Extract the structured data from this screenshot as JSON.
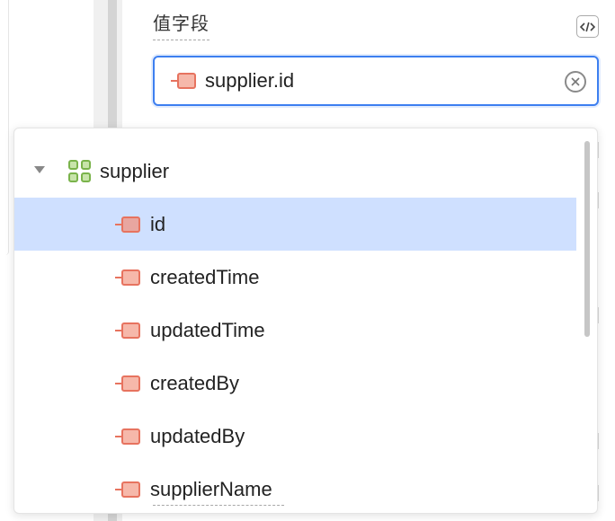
{
  "field": {
    "label": "值字段",
    "value": "supplier.id",
    "code_toggle_icon": "code-icon",
    "clear_icon": "clear-circle-icon"
  },
  "tree": {
    "group": {
      "label": "supplier",
      "icon": "entity-group-icon",
      "expanded": true
    },
    "items": [
      {
        "label": "id",
        "selected": true
      },
      {
        "label": "createdTime",
        "selected": false
      },
      {
        "label": "updatedTime",
        "selected": false
      },
      {
        "label": "createdBy",
        "selected": false
      },
      {
        "label": "updatedBy",
        "selected": false
      },
      {
        "label": "supplierName",
        "selected": false
      }
    ]
  },
  "colors": {
    "accent": "#3d7ff0",
    "selection": "#cfe0ff",
    "field_icon_stroke": "#e7735f",
    "field_icon_fill": "#f6b8aa",
    "group_icon": "#7ab34b"
  }
}
